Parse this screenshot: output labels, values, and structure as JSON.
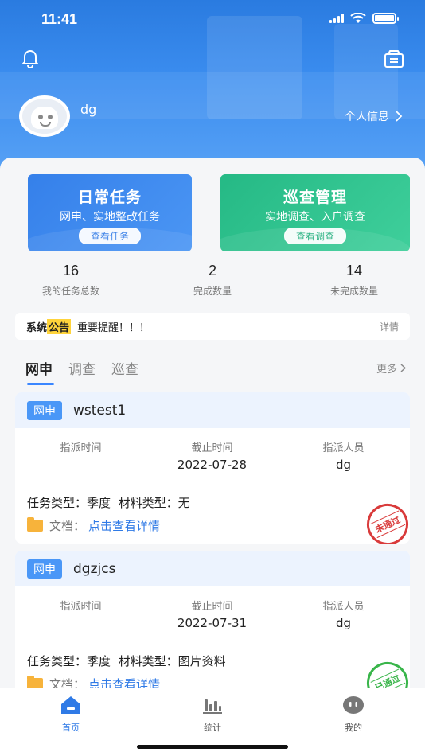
{
  "status_bar": {
    "time": "11:41"
  },
  "header": {
    "username": "dg",
    "profile_link": "个人信息"
  },
  "quick_cards": [
    {
      "title": "日常任务",
      "subtitle": "网申、实地整改任务",
      "button": "查看任务",
      "color": "#3580ea"
    },
    {
      "title": "巡查管理",
      "subtitle": "实地调查、入户调查",
      "button": "查看调查",
      "color": "#25b985"
    }
  ],
  "stats": [
    {
      "value": "16",
      "label": "我的任务总数"
    },
    {
      "value": "2",
      "label": "完成数量"
    },
    {
      "value": "14",
      "label": "未完成数量"
    }
  ],
  "notice": {
    "label1": "系统",
    "label2": "公告",
    "message": "重要提醒！！！",
    "more": "详情"
  },
  "tabs": {
    "items": [
      "网申",
      "调查",
      "巡查"
    ],
    "active": 0,
    "more": "更多"
  },
  "task_labels": {
    "assign_time": "指派时间",
    "deadline": "截止时间",
    "assignee": "指派人员",
    "task_type_prefix": "任务类型：",
    "material_type_prefix": "材料类型：",
    "doc_prefix": "文档：",
    "doc_link": "点击查看详情"
  },
  "tasks": [
    {
      "tag": "网申",
      "name": "wstest1",
      "assign_time": "",
      "deadline": "2022-07-28",
      "assignee": "dg",
      "task_type": "季度",
      "material_type": "无",
      "stamp": "未通过",
      "stamp_color": "#d93b3b"
    },
    {
      "tag": "网申",
      "name": "dgzjcs",
      "assign_time": "",
      "deadline": "2022-07-31",
      "assignee": "dg",
      "task_type": "季度",
      "material_type": "图片资料",
      "stamp": "已通过",
      "stamp_color": "#39b54a"
    }
  ],
  "bottom_nav": [
    {
      "label": "首页",
      "icon": "home-icon",
      "active": true
    },
    {
      "label": "统计",
      "icon": "bar-chart-icon",
      "active": false
    },
    {
      "label": "我的",
      "icon": "profile-icon",
      "active": false
    }
  ],
  "colors": {
    "primary": "#2f7ae6",
    "accent_green": "#25b985",
    "notice_highlight": "#ffd43b"
  }
}
